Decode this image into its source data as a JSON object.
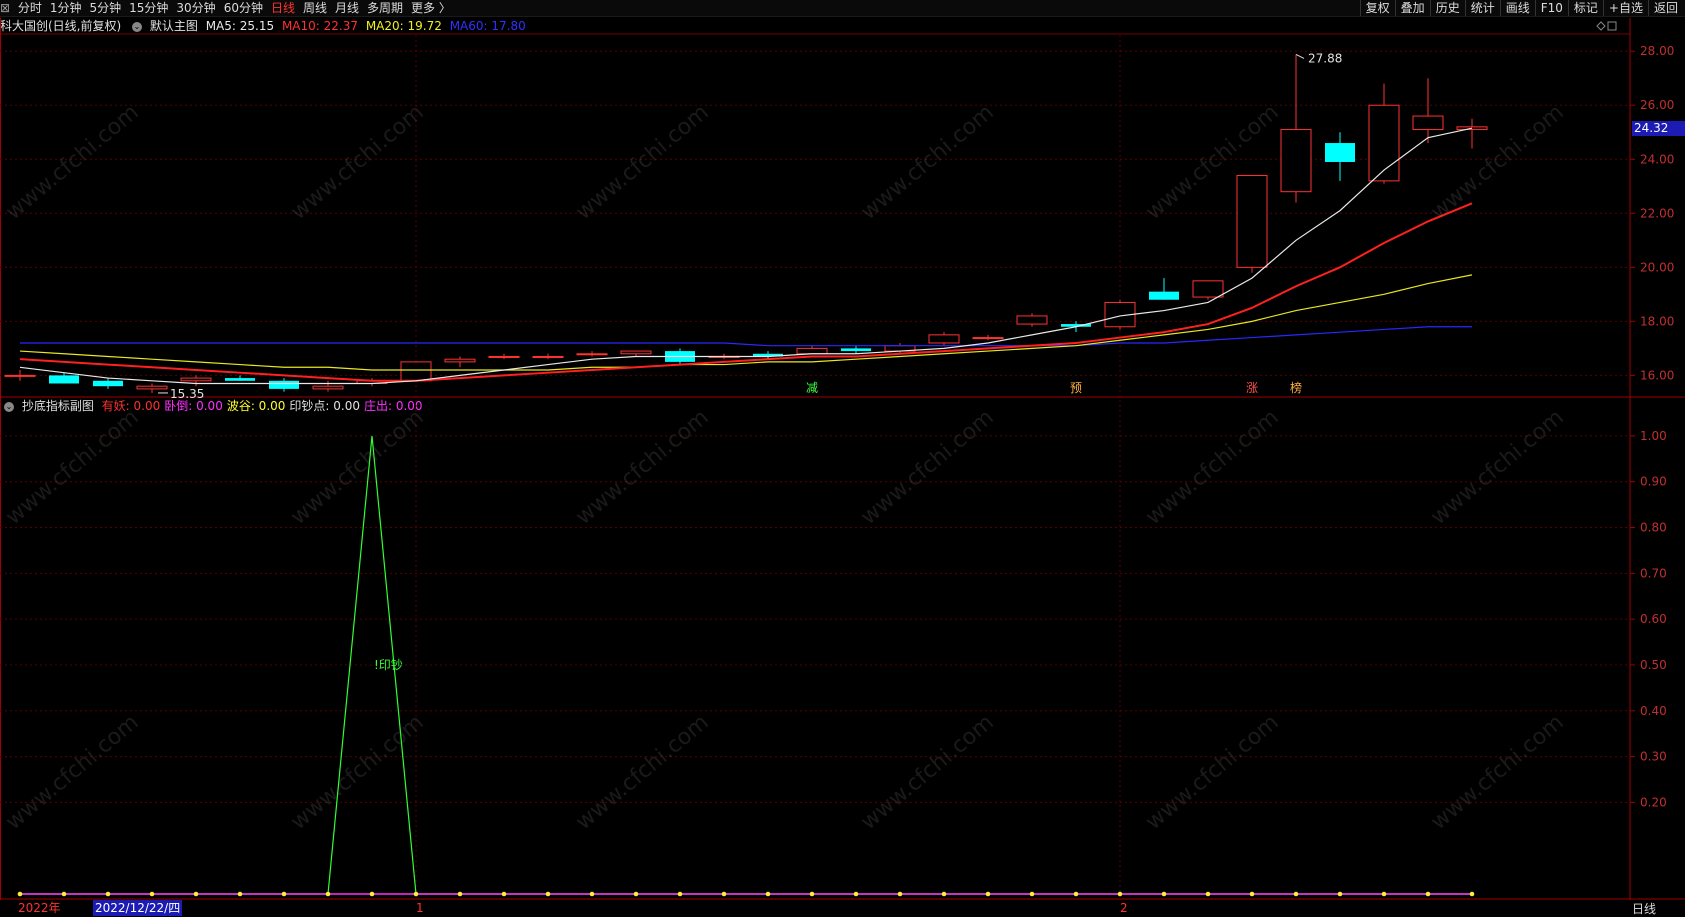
{
  "toolbar": {
    "left_items": [
      {
        "label": "分时",
        "active": false
      },
      {
        "label": "1分钟",
        "active": false
      },
      {
        "label": "5分钟",
        "active": false
      },
      {
        "label": "15分钟",
        "active": false
      },
      {
        "label": "30分钟",
        "active": false
      },
      {
        "label": "60分钟",
        "active": false
      },
      {
        "label": "日线",
        "active": true
      },
      {
        "label": "周线",
        "active": false
      },
      {
        "label": "月线",
        "active": false
      },
      {
        "label": "多周期",
        "active": false
      },
      {
        "label": "更多 〉",
        "active": false
      }
    ],
    "right_items": [
      "复权",
      "叠加",
      "历史",
      "统计",
      "画线",
      "F10",
      "标记",
      "+自选",
      "返回"
    ]
  },
  "main_chart": {
    "stock_name": "科大国创(日线,前复权)",
    "template": "默认主图",
    "ma5_label": "MA5: 25.15",
    "ma10_label": "MA10: 22.37",
    "ma20_label": "MA20: 19.72",
    "ma60_label": "MA60: 17.80",
    "high_marker": "27.88",
    "low_marker": "15.35",
    "current_price": "24.32",
    "y_ticks": [
      "28.00",
      "26.00",
      "24.00",
      "22.00",
      "20.00",
      "18.00",
      "16.00"
    ],
    "signal_labels": [
      "减",
      "预",
      "涨",
      "榜"
    ]
  },
  "sub_chart": {
    "title": "抄底指标副图",
    "vars": [
      {
        "label": "有妖: 0.00",
        "color": "#ff3030"
      },
      {
        "label": "卧倒: 0.00",
        "color": "#ff30ff"
      },
      {
        "label": "波谷: 0.00",
        "color": "#ffff30"
      },
      {
        "label": "印钞点: 0.00",
        "color": "#e0e0e0"
      },
      {
        "label": "庄出: 0.00",
        "color": "#ff30ff"
      }
    ],
    "annotation": "!印钞",
    "y_ticks": [
      "1.00",
      "0.90",
      "0.80",
      "0.70",
      "0.60",
      "0.50",
      "0.40",
      "0.30",
      "0.20"
    ]
  },
  "date_axis": {
    "year_label": "2022年",
    "cursor_date": "2022/12/22/四",
    "month_1": "1",
    "month_2": "2",
    "period": "日线"
  },
  "watermark_text": "www.cfchi.com",
  "chart_data": {
    "type": "candlestick",
    "title": "科大国创(日线,前复权)",
    "candles": [
      {
        "o": 16.0,
        "h": 16.2,
        "l": 15.8,
        "c": 16.0
      },
      {
        "o": 16.0,
        "h": 16.1,
        "l": 15.7,
        "c": 15.7
      },
      {
        "o": 15.8,
        "h": 15.9,
        "l": 15.5,
        "c": 15.6
      },
      {
        "o": 15.5,
        "h": 15.7,
        "l": 15.35,
        "c": 15.6
      },
      {
        "o": 15.8,
        "h": 16.0,
        "l": 15.6,
        "c": 15.9
      },
      {
        "o": 15.9,
        "h": 16.0,
        "l": 15.8,
        "c": 15.8
      },
      {
        "o": 15.8,
        "h": 15.9,
        "l": 15.4,
        "c": 15.5
      },
      {
        "o": 15.5,
        "h": 15.8,
        "l": 15.4,
        "c": 15.6
      },
      {
        "o": 15.7,
        "h": 15.9,
        "l": 15.6,
        "c": 15.8
      },
      {
        "o": 15.8,
        "h": 16.5,
        "l": 15.8,
        "c": 16.5
      },
      {
        "o": 16.5,
        "h": 16.7,
        "l": 16.3,
        "c": 16.6
      },
      {
        "o": 16.7,
        "h": 16.8,
        "l": 16.6,
        "c": 16.7
      },
      {
        "o": 16.7,
        "h": 16.8,
        "l": 16.6,
        "c": 16.7
      },
      {
        "o": 16.8,
        "h": 16.9,
        "l": 16.7,
        "c": 16.8
      },
      {
        "o": 16.8,
        "h": 16.9,
        "l": 16.7,
        "c": 16.9
      },
      {
        "o": 16.9,
        "h": 17.0,
        "l": 16.4,
        "c": 16.5
      },
      {
        "o": 16.7,
        "h": 16.8,
        "l": 16.6,
        "c": 16.7
      },
      {
        "o": 16.8,
        "h": 16.9,
        "l": 16.6,
        "c": 16.7
      },
      {
        "o": 16.8,
        "h": 17.1,
        "l": 16.8,
        "c": 17.0
      },
      {
        "o": 17.0,
        "h": 17.1,
        "l": 16.8,
        "c": 16.9
      },
      {
        "o": 16.9,
        "h": 17.2,
        "l": 16.8,
        "c": 17.1
      },
      {
        "o": 17.2,
        "h": 17.6,
        "l": 17.1,
        "c": 17.5
      },
      {
        "o": 17.4,
        "h": 17.5,
        "l": 17.3,
        "c": 17.4
      },
      {
        "o": 17.9,
        "h": 18.3,
        "l": 17.8,
        "c": 18.2
      },
      {
        "o": 17.9,
        "h": 18.0,
        "l": 17.6,
        "c": 17.8
      },
      {
        "o": 17.8,
        "h": 18.8,
        "l": 17.7,
        "c": 18.7
      },
      {
        "o": 19.1,
        "h": 19.6,
        "l": 18.8,
        "c": 18.8
      },
      {
        "o": 18.9,
        "h": 19.5,
        "l": 18.8,
        "c": 19.5
      },
      {
        "o": 20.0,
        "h": 23.4,
        "l": 19.8,
        "c": 23.4
      },
      {
        "o": 22.8,
        "h": 27.88,
        "l": 22.4,
        "c": 25.1
      },
      {
        "o": 24.6,
        "h": 25.0,
        "l": 23.2,
        "c": 23.9
      },
      {
        "o": 23.2,
        "h": 26.8,
        "l": 23.1,
        "c": 26.0
      },
      {
        "o": 25.1,
        "h": 27.0,
        "l": 24.6,
        "c": 25.6
      },
      {
        "o": 25.1,
        "h": 25.5,
        "l": 24.4,
        "c": 25.2
      }
    ],
    "ma5": [
      16.3,
      16.1,
      15.9,
      15.8,
      15.7,
      15.7,
      15.7,
      15.7,
      15.7,
      15.8,
      16.0,
      16.2,
      16.4,
      16.6,
      16.7,
      16.7,
      16.7,
      16.7,
      16.8,
      16.8,
      16.9,
      17.0,
      17.2,
      17.5,
      17.8,
      18.2,
      18.4,
      18.7,
      19.6,
      21.0,
      22.1,
      23.6,
      24.8,
      25.15
    ],
    "ma10": [
      16.6,
      16.5,
      16.4,
      16.3,
      16.2,
      16.1,
      16.0,
      15.9,
      15.8,
      15.8,
      15.9,
      16.0,
      16.1,
      16.2,
      16.3,
      16.4,
      16.5,
      16.6,
      16.7,
      16.7,
      16.8,
      16.9,
      17.0,
      17.1,
      17.2,
      17.4,
      17.6,
      17.9,
      18.5,
      19.3,
      20.0,
      20.9,
      21.7,
      22.37
    ],
    "ma20": [
      16.9,
      16.8,
      16.7,
      16.6,
      16.5,
      16.4,
      16.3,
      16.3,
      16.2,
      16.2,
      16.2,
      16.2,
      16.2,
      16.3,
      16.3,
      16.4,
      16.4,
      16.5,
      16.5,
      16.6,
      16.7,
      16.8,
      16.9,
      17.0,
      17.1,
      17.3,
      17.5,
      17.7,
      18.0,
      18.4,
      18.7,
      19.0,
      19.4,
      19.72
    ],
    "ma60": [
      17.2,
      17.2,
      17.2,
      17.2,
      17.2,
      17.2,
      17.2,
      17.2,
      17.2,
      17.2,
      17.2,
      17.2,
      17.2,
      17.2,
      17.2,
      17.2,
      17.2,
      17.1,
      17.1,
      17.1,
      17.1,
      17.1,
      17.1,
      17.1,
      17.1,
      17.2,
      17.2,
      17.3,
      17.4,
      17.5,
      17.6,
      17.7,
      17.8,
      17.8
    ],
    "price_ylim": [
      15.2,
      28.6
    ],
    "indicator": {
      "name": "抄底指标副图",
      "values": [
        0,
        0,
        0,
        0,
        0,
        0,
        0,
        0,
        1,
        0,
        0,
        0,
        0,
        0,
        0,
        0,
        0,
        0,
        0,
        0,
        0,
        0,
        0,
        0,
        0,
        0,
        0,
        0,
        0,
        0,
        0,
        0,
        0,
        0
      ],
      "ylim": [
        0,
        1.05
      ]
    },
    "signal_indices": [
      18,
      24,
      28,
      29
    ]
  }
}
